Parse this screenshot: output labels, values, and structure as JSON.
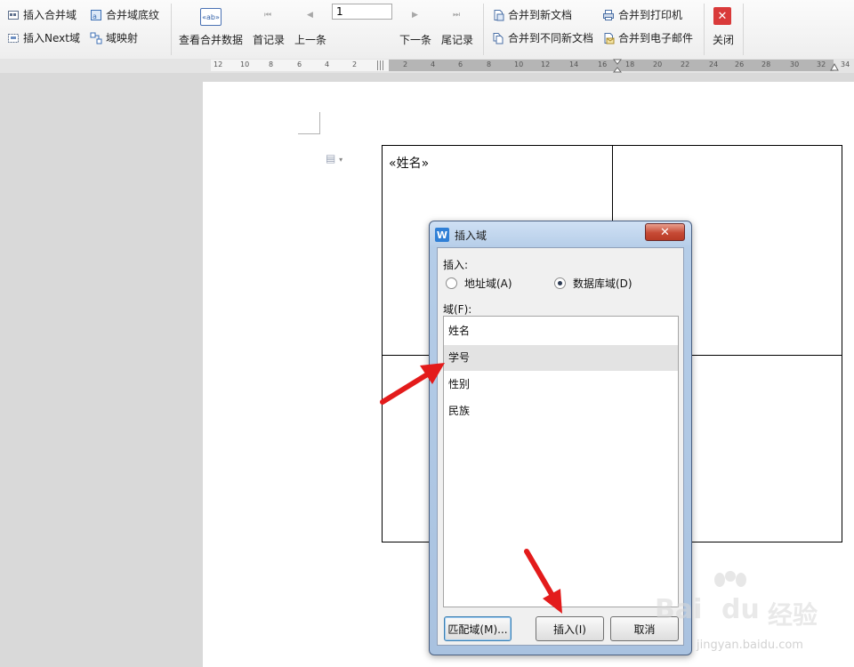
{
  "ribbon": {
    "insert_merge_field": "插入合并域",
    "insert_next_field": "插入Next域",
    "merge_field_shading": "合并域底纹",
    "field_mapping": "域映射",
    "view_merged_data": "查看合并数据",
    "first_record": "首记录",
    "previous": "上一条",
    "record_number": "1",
    "next": "下一条",
    "last_record": "尾记录",
    "merge_to_new_doc": "合并到新文档",
    "merge_to_diff_docs": "合并到不同新文档",
    "merge_to_printer": "合并到打印机",
    "merge_to_email": "合并到电子邮件",
    "close": "关闭",
    "close_icon_glyph": "✕",
    "view_data_icon_text": "«ab»"
  },
  "ruler": {
    "labels": [
      "12",
      "10",
      "8",
      "6",
      "4",
      "2",
      "2",
      "4",
      "6",
      "8",
      "10",
      "12",
      "14",
      "16",
      "18",
      "20",
      "22",
      "24",
      "26",
      "28",
      "30",
      "32",
      "34"
    ]
  },
  "document": {
    "cell_field": "«姓名»"
  },
  "dialog": {
    "title": "插入域",
    "logo_letter": "W",
    "close_glyph": "✕",
    "insert_label": "插入:",
    "address_field": "地址域(A)",
    "database_field": "数据库域(D)",
    "selected_type": "database",
    "fields_label": "域(F):",
    "fields": [
      "姓名",
      "学号",
      "性别",
      "民族"
    ],
    "selected_field": "学号",
    "match_button": "匹配域(M)...",
    "insert_button": "插入(I)",
    "cancel_button": "取消"
  },
  "watermark": {
    "brand": "Bai",
    "paw": "du",
    "product": "经验",
    "url": "jingyan.baidu.com"
  },
  "colors": {
    "annotation_arrow": "#e31b1b",
    "close_button": "#d93a3a",
    "dialog_frame": "#b5cde8"
  }
}
